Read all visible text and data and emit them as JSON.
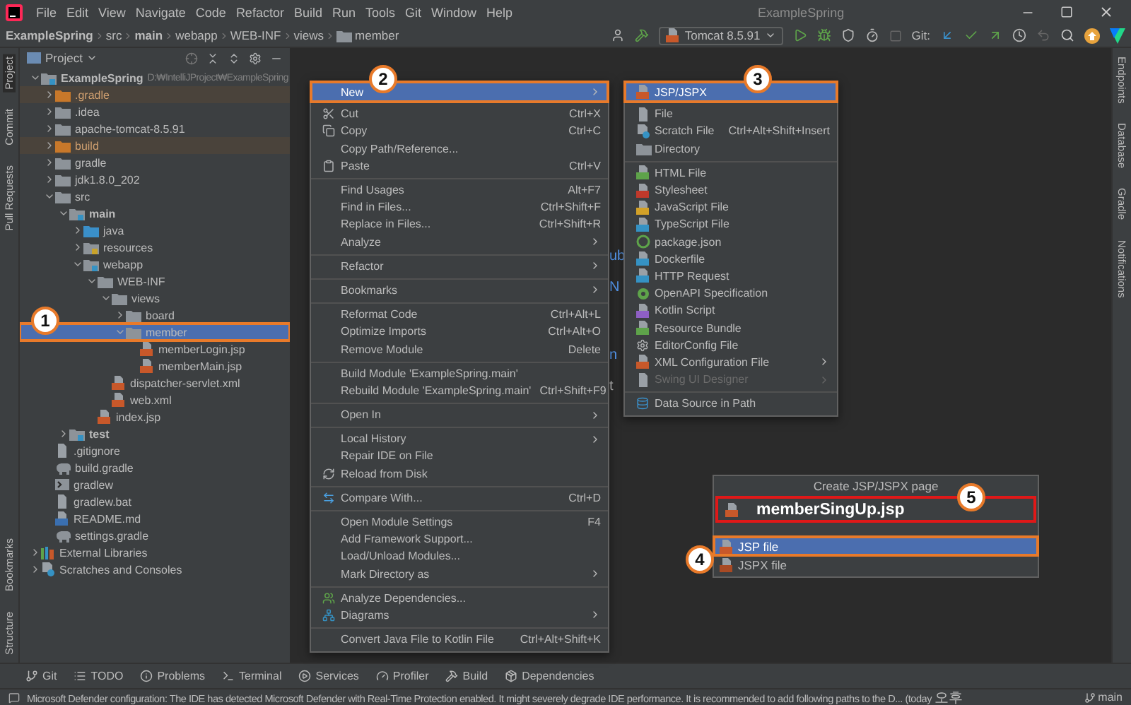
{
  "title_bar": {
    "menu": [
      "File",
      "Edit",
      "View",
      "Navigate",
      "Code",
      "Refactor",
      "Build",
      "Run",
      "Tools",
      "Git",
      "Window",
      "Help"
    ],
    "title": "ExampleSpring"
  },
  "nav_bar": {
    "breadcrumbs": [
      {
        "label": "ExampleSpring",
        "bold": true
      },
      {
        "label": "src",
        "bold": false
      },
      {
        "label": "main",
        "bold": true
      },
      {
        "label": "webapp",
        "bold": false
      },
      {
        "label": "WEB-INF",
        "bold": false
      },
      {
        "label": "views",
        "bold": false
      },
      {
        "label": "member",
        "bold": false
      }
    ],
    "run_config": "Tomcat 8.5.91",
    "vcs_label": "Git:"
  },
  "left_strip": {
    "top": [
      {
        "label": "Project",
        "selected": true
      },
      {
        "label": "Commit",
        "selected": false
      },
      {
        "label": "Pull Requests",
        "selected": false
      }
    ],
    "bottom": [
      {
        "label": "Bookmarks",
        "selected": false
      },
      {
        "label": "Structure",
        "selected": false
      }
    ]
  },
  "right_strip": [
    "Endpoints",
    "Database",
    "Gradle",
    "Notifications"
  ],
  "project_panel": {
    "title": "Project",
    "tree": [
      {
        "name": "ExampleSpring",
        "path": "D:₩IntelliJProject₩ExampleSpring",
        "kind": "module",
        "expanded": true,
        "selected": false,
        "excluded": false,
        "children": [
          {
            "name": ".gradle",
            "kind": "folder",
            "expanded": false,
            "selected": false,
            "excluded": true
          },
          {
            "name": ".idea",
            "kind": "folder",
            "expanded": false,
            "selected": false,
            "excluded": false
          },
          {
            "name": "apache-tomcat-8.5.91",
            "kind": "folder",
            "expanded": false,
            "selected": false,
            "excluded": false
          },
          {
            "name": "build",
            "kind": "folder",
            "expanded": false,
            "selected": false,
            "excluded": true
          },
          {
            "name": "gradle",
            "kind": "folder",
            "expanded": false,
            "selected": false,
            "excluded": false
          },
          {
            "name": "jdk1.8.0_202",
            "kind": "folder",
            "expanded": false,
            "selected": false,
            "excluded": false
          },
          {
            "name": "src",
            "kind": "folder",
            "expanded": true,
            "selected": false,
            "excluded": false,
            "children": [
              {
                "name": "main",
                "kind": "module",
                "expanded": true,
                "selected": false,
                "excluded": false,
                "children": [
                  {
                    "name": "java",
                    "kind": "source",
                    "expanded": false,
                    "selected": false,
                    "excluded": false
                  },
                  {
                    "name": "resources",
                    "kind": "resources",
                    "expanded": false,
                    "selected": false,
                    "excluded": false
                  },
                  {
                    "name": "webapp",
                    "kind": "web",
                    "expanded": true,
                    "selected": false,
                    "excluded": false,
                    "children": [
                      {
                        "name": "WEB-INF",
                        "kind": "folder",
                        "expanded": true,
                        "selected": false,
                        "excluded": false,
                        "children": [
                          {
                            "name": "views",
                            "kind": "folder",
                            "expanded": true,
                            "selected": false,
                            "excluded": false,
                            "children": [
                              {
                                "name": "board",
                                "kind": "folder",
                                "expanded": false,
                                "selected": false,
                                "excluded": false
                              },
                              {
                                "name": "member",
                                "kind": "folder",
                                "expanded": true,
                                "selected": true,
                                "excluded": false,
                                "children": [
                                  {
                                    "name": "memberLogin.jsp",
                                    "kind": "jsp",
                                    "selected": false,
                                    "excluded": false
                                  },
                                  {
                                    "name": "memberMain.jsp",
                                    "kind": "jsp",
                                    "selected": false,
                                    "excluded": false
                                  }
                                ]
                              }
                            ]
                          },
                          {
                            "name": "dispatcher-servlet.xml",
                            "kind": "xml",
                            "selected": false,
                            "excluded": false
                          },
                          {
                            "name": "web.xml",
                            "kind": "xml",
                            "selected": false,
                            "excluded": false
                          }
                        ]
                      },
                      {
                        "name": "index.jsp",
                        "kind": "jsp",
                        "selected": false,
                        "excluded": false
                      }
                    ]
                  }
                ]
              },
              {
                "name": "test",
                "kind": "module",
                "expanded": false,
                "selected": false,
                "excluded": false
              }
            ]
          },
          {
            "name": ".gitignore",
            "kind": "file",
            "selected": false,
            "excluded": false
          },
          {
            "name": "build.gradle",
            "kind": "gradle",
            "selected": false,
            "excluded": false
          },
          {
            "name": "gradlew",
            "kind": "script",
            "selected": false,
            "excluded": false
          },
          {
            "name": "gradlew.bat",
            "kind": "file",
            "selected": false,
            "excluded": false
          },
          {
            "name": "README.md",
            "kind": "md",
            "selected": false,
            "excluded": false
          },
          {
            "name": "settings.gradle",
            "kind": "gradle",
            "selected": false,
            "excluded": false
          }
        ]
      },
      {
        "name": "External Libraries",
        "kind": "libraries",
        "expanded": false,
        "selected": false,
        "excluded": false
      },
      {
        "name": "Scratches and Consoles",
        "kind": "scratches",
        "expanded": false,
        "selected": false,
        "excluded": false
      }
    ]
  },
  "editor_fragments": [
    {
      "text": "ub",
      "kind": "link"
    },
    {
      "text": "N",
      "kind": "link"
    },
    {
      "text": "n",
      "kind": "link"
    },
    {
      "text": "t",
      "kind": "plain"
    }
  ],
  "context_menu": [
    [
      {
        "label": "New",
        "submenu": true,
        "selected": true
      }
    ],
    [
      {
        "label": "Cut",
        "shortcut": "Ctrl+X",
        "kind": "cut",
        "selected": false
      },
      {
        "label": "Copy",
        "shortcut": "Ctrl+C",
        "kind": "copy",
        "selected": false
      },
      {
        "label": "Copy Path/Reference...",
        "selected": false
      },
      {
        "label": "Paste",
        "shortcut": "Ctrl+V",
        "kind": "paste",
        "selected": false
      }
    ],
    [
      {
        "label": "Find Usages",
        "shortcut": "Alt+F7",
        "selected": false
      },
      {
        "label": "Find in Files...",
        "shortcut": "Ctrl+Shift+F",
        "selected": false
      },
      {
        "label": "Replace in Files...",
        "shortcut": "Ctrl+Shift+R",
        "selected": false
      },
      {
        "label": "Analyze",
        "submenu": true,
        "selected": false
      }
    ],
    [
      {
        "label": "Refactor",
        "submenu": true,
        "selected": false
      }
    ],
    [
      {
        "label": "Bookmarks",
        "submenu": true,
        "selected": false
      }
    ],
    [
      {
        "label": "Reformat Code",
        "shortcut": "Ctrl+Alt+L",
        "selected": false
      },
      {
        "label": "Optimize Imports",
        "shortcut": "Ctrl+Alt+O",
        "selected": false
      },
      {
        "label": "Remove Module",
        "shortcut": "Delete",
        "selected": false
      }
    ],
    [
      {
        "label": "Build Module 'ExampleSpring.main'",
        "selected": false
      },
      {
        "label": "Rebuild Module 'ExampleSpring.main'",
        "shortcut": "Ctrl+Shift+F9",
        "selected": false
      }
    ],
    [
      {
        "label": "Open In",
        "submenu": true,
        "selected": false
      }
    ],
    [
      {
        "label": "Local History",
        "submenu": true,
        "selected": false
      },
      {
        "label": "Repair IDE on File",
        "selected": false
      },
      {
        "label": "Reload from Disk",
        "kind": "reload",
        "selected": false
      }
    ],
    [
      {
        "label": "Compare With...",
        "shortcut": "Ctrl+D",
        "kind": "compare",
        "selected": false
      }
    ],
    [
      {
        "label": "Open Module Settings",
        "shortcut": "F4",
        "selected": false
      },
      {
        "label": "Add Framework Support...",
        "selected": false
      },
      {
        "label": "Load/Unload Modules...",
        "selected": false
      },
      {
        "label": "Mark Directory as",
        "submenu": true,
        "selected": false
      }
    ],
    [
      {
        "label": "Analyze Dependencies...",
        "kind": "analyze",
        "selected": false
      },
      {
        "label": "Diagrams",
        "kind": "diagram",
        "submenu": true,
        "selected": false
      }
    ],
    [
      {
        "label": "Convert Java File to Kotlin File",
        "shortcut": "Ctrl+Alt+Shift+K",
        "selected": false
      }
    ]
  ],
  "new_submenu": [
    [
      {
        "label": "JSP/JSPX",
        "kind": "jsp",
        "selected": true,
        "disabled": false
      }
    ],
    [
      {
        "label": "File",
        "kind": "file",
        "selected": false,
        "disabled": false
      },
      {
        "label": "Scratch File",
        "shortcut": "Ctrl+Alt+Shift+Insert",
        "kind": "scratch",
        "selected": false,
        "disabled": false
      },
      {
        "label": "Directory",
        "kind": "folder",
        "selected": false,
        "disabled": false
      }
    ],
    [
      {
        "label": "HTML File",
        "kind": "html",
        "selected": false,
        "disabled": false
      },
      {
        "label": "Stylesheet",
        "kind": "css",
        "selected": false,
        "disabled": false
      },
      {
        "label": "JavaScript File",
        "kind": "js",
        "selected": false,
        "disabled": false
      },
      {
        "label": "TypeScript File",
        "kind": "ts",
        "selected": false,
        "disabled": false
      },
      {
        "label": "package.json",
        "kind": "npm",
        "selected": false,
        "disabled": false
      },
      {
        "label": "Dockerfile",
        "kind": "docker",
        "selected": false,
        "disabled": false
      },
      {
        "label": "HTTP Request",
        "kind": "http",
        "selected": false,
        "disabled": false
      },
      {
        "label": "OpenAPI Specification",
        "kind": "openapi",
        "selected": false,
        "disabled": false
      },
      {
        "label": "Kotlin Script",
        "kind": "kotlin",
        "selected": false,
        "disabled": false
      },
      {
        "label": "Resource Bundle",
        "kind": "bundle",
        "selected": false,
        "disabled": false
      },
      {
        "label": "EditorConfig File",
        "kind": "gear",
        "selected": false,
        "disabled": false
      },
      {
        "label": "XML Configuration File",
        "kind": "xml",
        "submenu": true,
        "selected": false,
        "disabled": false
      },
      {
        "label": "Swing UI Designer",
        "kind": "file",
        "submenu": true,
        "selected": false,
        "disabled": true
      }
    ],
    [
      {
        "label": "Data Source in Path",
        "kind": "database",
        "selected": false,
        "disabled": false
      }
    ]
  ],
  "create_dialog": {
    "title": "Create JSP/JSPX page",
    "value": "memberSingUp.jsp",
    "options": [
      {
        "label": "JSP file",
        "kind": "jsp",
        "selected": true
      },
      {
        "label": "JSPX file",
        "kind": "jspx",
        "selected": false
      }
    ]
  },
  "callouts": [
    "1",
    "2",
    "3",
    "4",
    "5"
  ],
  "tool_windows": [
    {
      "label": "Git",
      "kind": "git"
    },
    {
      "label": "TODO",
      "kind": "list"
    },
    {
      "label": "Problems",
      "kind": "problems"
    },
    {
      "label": "Terminal",
      "kind": "terminal"
    },
    {
      "label": "Services",
      "kind": "services"
    },
    {
      "label": "Profiler",
      "kind": "profiler"
    },
    {
      "label": "Build",
      "kind": "build"
    },
    {
      "label": "Dependencies",
      "kind": "deps"
    }
  ],
  "status_bar": {
    "message": "Microsoft Defender configuration: The IDE has detected Microsoft Defender with Real-Time Protection enabled. It might severely degrade IDE performance. It is recommended to add following paths to the D... (today",
    "message_tail": "오후",
    "branch": "main"
  }
}
